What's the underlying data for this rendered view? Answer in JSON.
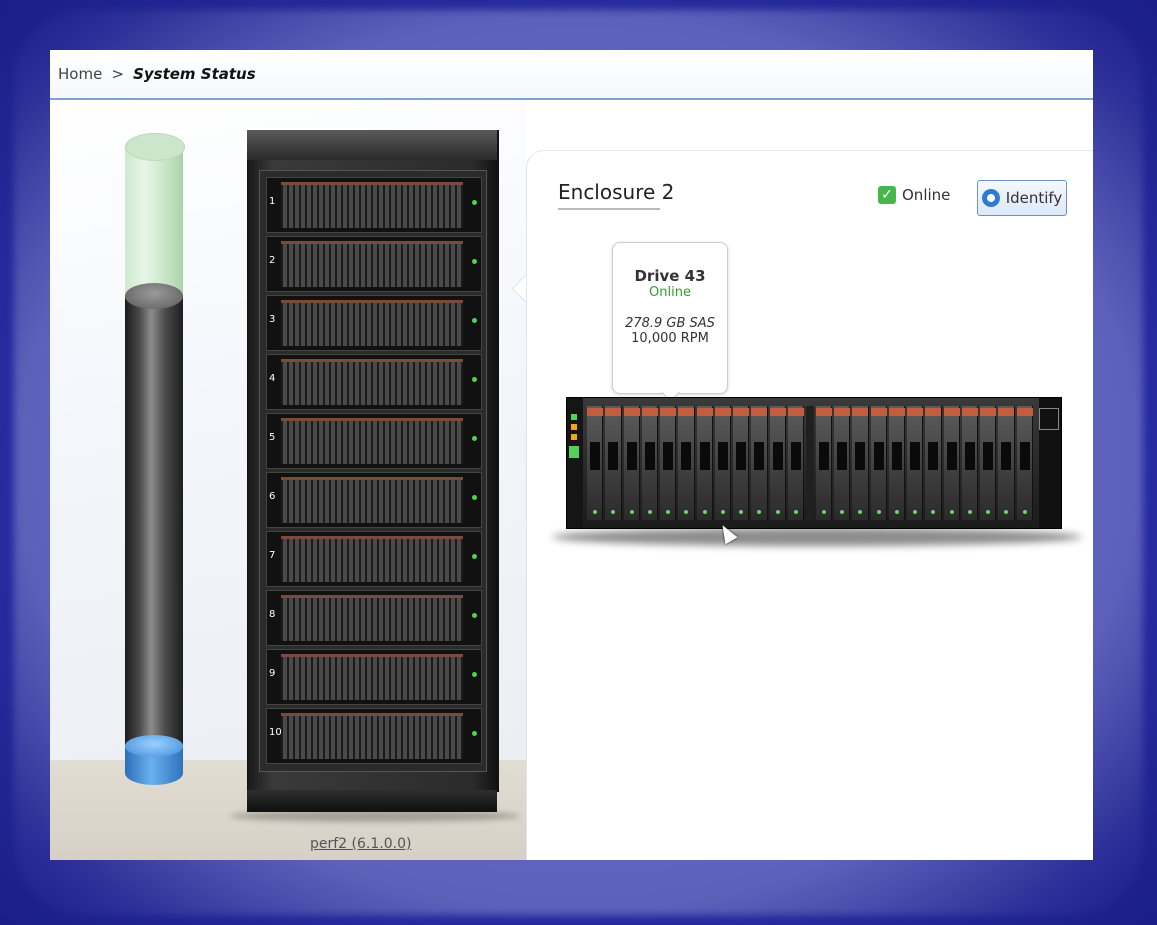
{
  "breadcrumb": {
    "home": "Home",
    "separator": ">",
    "current": "System Status"
  },
  "system": {
    "name": "perf2 (6.1.0.0)",
    "rack_slots": [
      "1",
      "2",
      "3",
      "4",
      "5",
      "6",
      "7",
      "8",
      "9",
      "10"
    ]
  },
  "enclosure_panel": {
    "title": "Enclosure 2",
    "status": "Online",
    "identify_label": "Identify",
    "tooltip": {
      "drive_name": "Drive 43",
      "drive_status": "Online",
      "capacity_type": "278.9 GB SAS",
      "rpm": "10,000 RPM"
    }
  },
  "colors": {
    "frame": "#2a2fa8",
    "online_green": "#2e9e2e",
    "accent": "#6c91c9"
  }
}
